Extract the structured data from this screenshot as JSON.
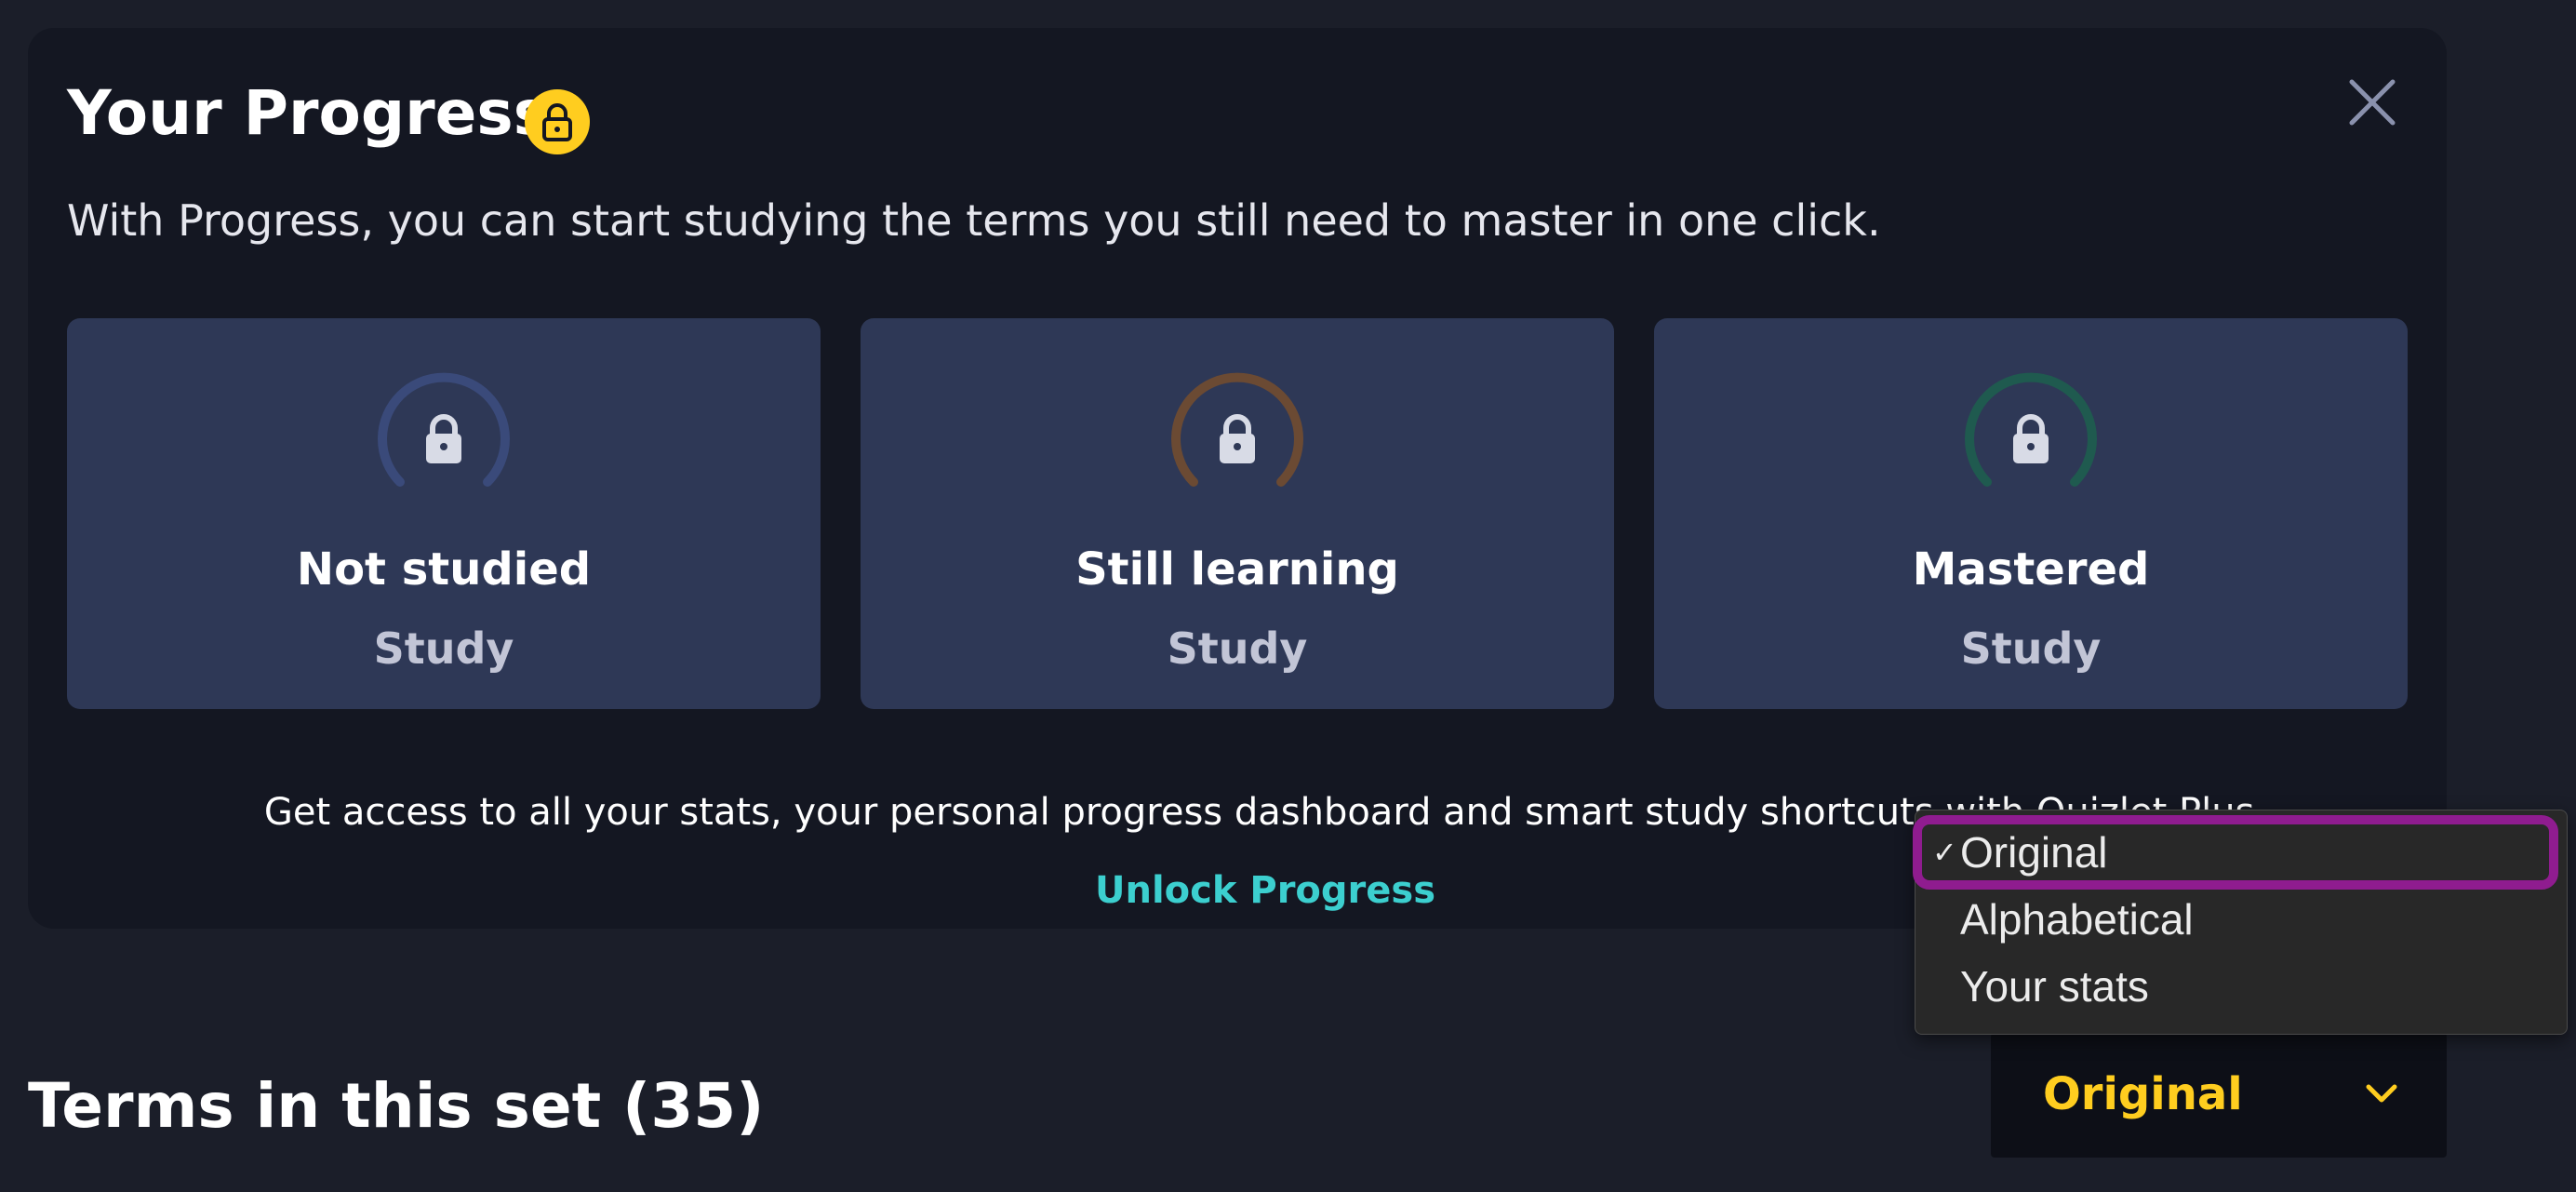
{
  "progress": {
    "title": "Your Progress",
    "subtitle": "With Progress, you can start studying the terms you still need to master in one click.",
    "cards": [
      {
        "label": "Not studied",
        "action": "Study",
        "ring_color": "#3a4a7a"
      },
      {
        "label": "Still learning",
        "action": "Study",
        "ring_color": "#6b4a33"
      },
      {
        "label": "Mastered",
        "action": "Study",
        "ring_color": "#1f5a4f"
      }
    ],
    "promo_text": "Get access to all your stats, your personal progress dashboard and smart study shortcuts with Quizlet Plus.",
    "unlock_label": "Unlock Progress",
    "icons": {
      "title": "lock-icon",
      "close": "close-icon"
    }
  },
  "terms": {
    "heading": "Terms in this set (35)"
  },
  "sort": {
    "selected": "Original",
    "options": [
      {
        "label": "Original",
        "checked": true
      },
      {
        "label": "Alphabetical",
        "checked": false
      },
      {
        "label": "Your stats",
        "checked": false
      }
    ],
    "check_mark": "✓"
  },
  "colors": {
    "accent_yellow": "#ffcd1f",
    "accent_teal": "#3ccfcf",
    "card_bg": "#2e3856",
    "highlight": "#8f1c8f"
  }
}
